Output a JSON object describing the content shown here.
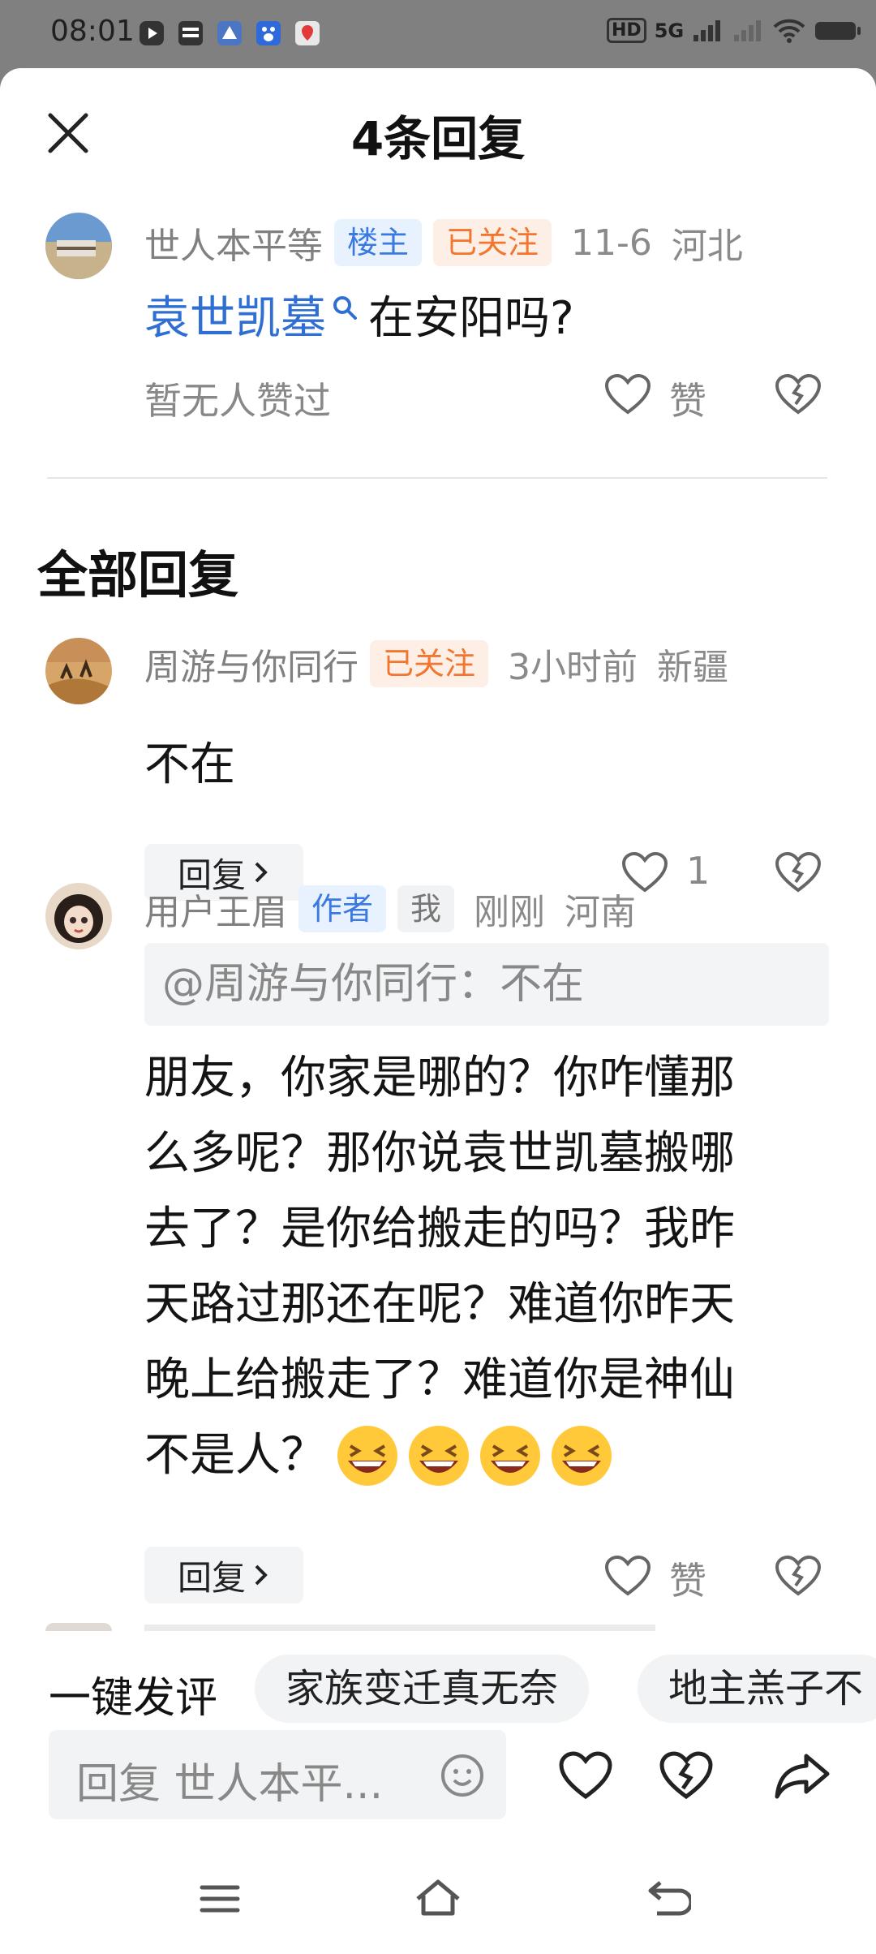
{
  "status_bar": {
    "time": "08:01",
    "left_icons": [
      "video-app-icon",
      "toutiao-icon",
      "xiaohongshu-icon",
      "baidu-icon",
      "map-pin-app-icon"
    ],
    "network_text": "5G",
    "hd_text": "HD"
  },
  "header": {
    "title": "4条回复"
  },
  "main_comment": {
    "username": "世人本平等",
    "owner_badge": "楼主",
    "follow_badge": "已关注",
    "date": "11-6",
    "location": "河北",
    "link_text": "袁世凯墓",
    "text": "在安阳吗?",
    "likes_text": "暂无人赞过",
    "like_label": "赞"
  },
  "section_title": "全部回复",
  "replies": [
    {
      "username": "周游与你同行",
      "follow_badge": "已关注",
      "time": "3小时前",
      "location": "新疆",
      "text": "不在",
      "reply_label": "回复",
      "like_count": "1"
    },
    {
      "username": "用户王眉",
      "author_badge": "作者",
      "me_badge": "我",
      "time": "刚刚",
      "location": "河南",
      "quote": "@周游与你同行：不在",
      "lines": [
        "朋友，你家是哪的？你咋懂那",
        "么多呢？那你说袁世凯墓搬哪",
        "去了？是你给搬走的吗？我昨",
        "天路过那还在呢？难道你昨天",
        "晚上给搬走了？难道你是神仙",
        "不是人？"
      ],
      "emojis": [
        "grinning-squint-emoji",
        "grinning-squint-emoji",
        "grinning-squint-emoji",
        "grinning-squint-emoji"
      ],
      "reply_label": "回复",
      "like_label": "赞"
    }
  ],
  "quick_reply": {
    "label": "一键发评",
    "chips": [
      "家族变迁真无奈",
      "地主羔子不"
    ]
  },
  "input": {
    "placeholder": "回复 世人本平..."
  },
  "colors": {
    "link": "#2f6fd4",
    "follow_orange": "#f2762e",
    "badge_blue": "#3a79e0"
  }
}
